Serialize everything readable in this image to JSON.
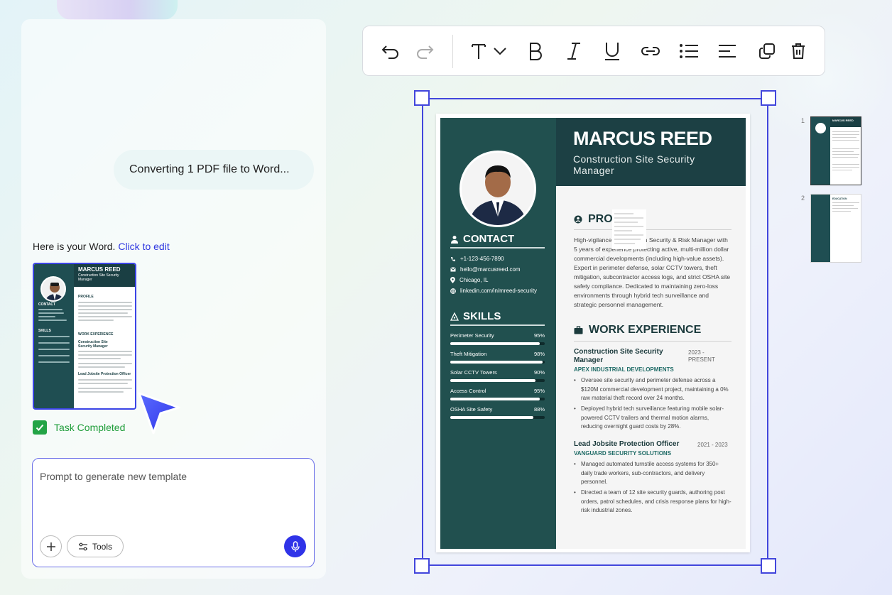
{
  "chat": {
    "status_message": "Converting 1 PDF file to Word...",
    "result_text": "Here is your Word.",
    "edit_link": "Click to edit",
    "task_status": "Task Completed"
  },
  "prompt": {
    "placeholder": "Prompt to generate new template",
    "tools_label": "Tools"
  },
  "resume": {
    "name": "MARCUS REED",
    "role": "Construction Site Security Manager",
    "contact_title": "CONTACT",
    "contact": {
      "phone": "+1-123-456-7890",
      "email": "hello@marcusreed.com",
      "location": "Chicago, IL",
      "linkedin": "linkedin.com/in/mreed-security"
    },
    "skills_title": "SKILLS",
    "skills": [
      {
        "name": "Perimeter Security",
        "pct": 95,
        "label": "95%"
      },
      {
        "name": "Theft Mitigation",
        "pct": 98,
        "label": "98%"
      },
      {
        "name": "Solar CCTV Towers",
        "pct": 90,
        "label": "90%"
      },
      {
        "name": "Access Control",
        "pct": 95,
        "label": "95%"
      },
      {
        "name": "OSHA Site Safety",
        "pct": 88,
        "label": "88%"
      }
    ],
    "profile_title": "PRO",
    "profile_text": "High-vigilance Construction Security & Risk Manager with 5 years of experience protecting active, multi-million dollar commercial developments (including high-value assets). Expert in perimeter defense, solar CCTV towers, theft mitigation, subcontractor access logs, and strict OSHA site safety compliance. Dedicated to maintaining zero-loss environments through hybrid tech surveillance and strategic personnel management.",
    "work_title": "WORK EXPERIENCE",
    "jobs": [
      {
        "title": "Construction Site Security Manager",
        "dates": "2023 - PRESENT",
        "company": "APEX INDUSTRIAL DEVELOPMENTS",
        "bullets": [
          "Oversee site security and perimeter defense across a $120M commercial development project, maintaining a 0% raw material theft record over 24 months.",
          "Deployed hybrid tech surveillance featuring mobile solar-powered CCTV trailers and thermal motion alarms, reducing overnight guard costs by 28%."
        ]
      },
      {
        "title": "Lead Jobsite Protection Officer",
        "dates": "2021 - 2023",
        "company": "VANGUARD SECURITY SOLUTIONS",
        "bullets": [
          "Managed automated turnstile access systems for 350+ daily trade workers, sub-contractors, and delivery personnel.",
          "Directed a team of 12 site security guards, authoring post orders, patrol schedules, and crisis response plans for high-risk industrial zones."
        ]
      }
    ]
  },
  "thumbnail": {
    "name": "MARCUS REED",
    "role": "Construction Site Security Manager",
    "profile": "PROFILE",
    "work": "WORK EXPERIENCE",
    "contact": "CONTACT",
    "skills": "SKILLS",
    "job1": "Construction Site Security Manager",
    "job2": "Lead Jobsite Protection Officer"
  },
  "pages": [
    {
      "number": "1",
      "heading": "MARCUS REED"
    },
    {
      "number": "2",
      "heading": "EDUCATION"
    }
  ],
  "colors": {
    "accent": "#3b44e6",
    "sidebar": "#21504f",
    "header": "#1c4044",
    "success": "#23a446"
  }
}
